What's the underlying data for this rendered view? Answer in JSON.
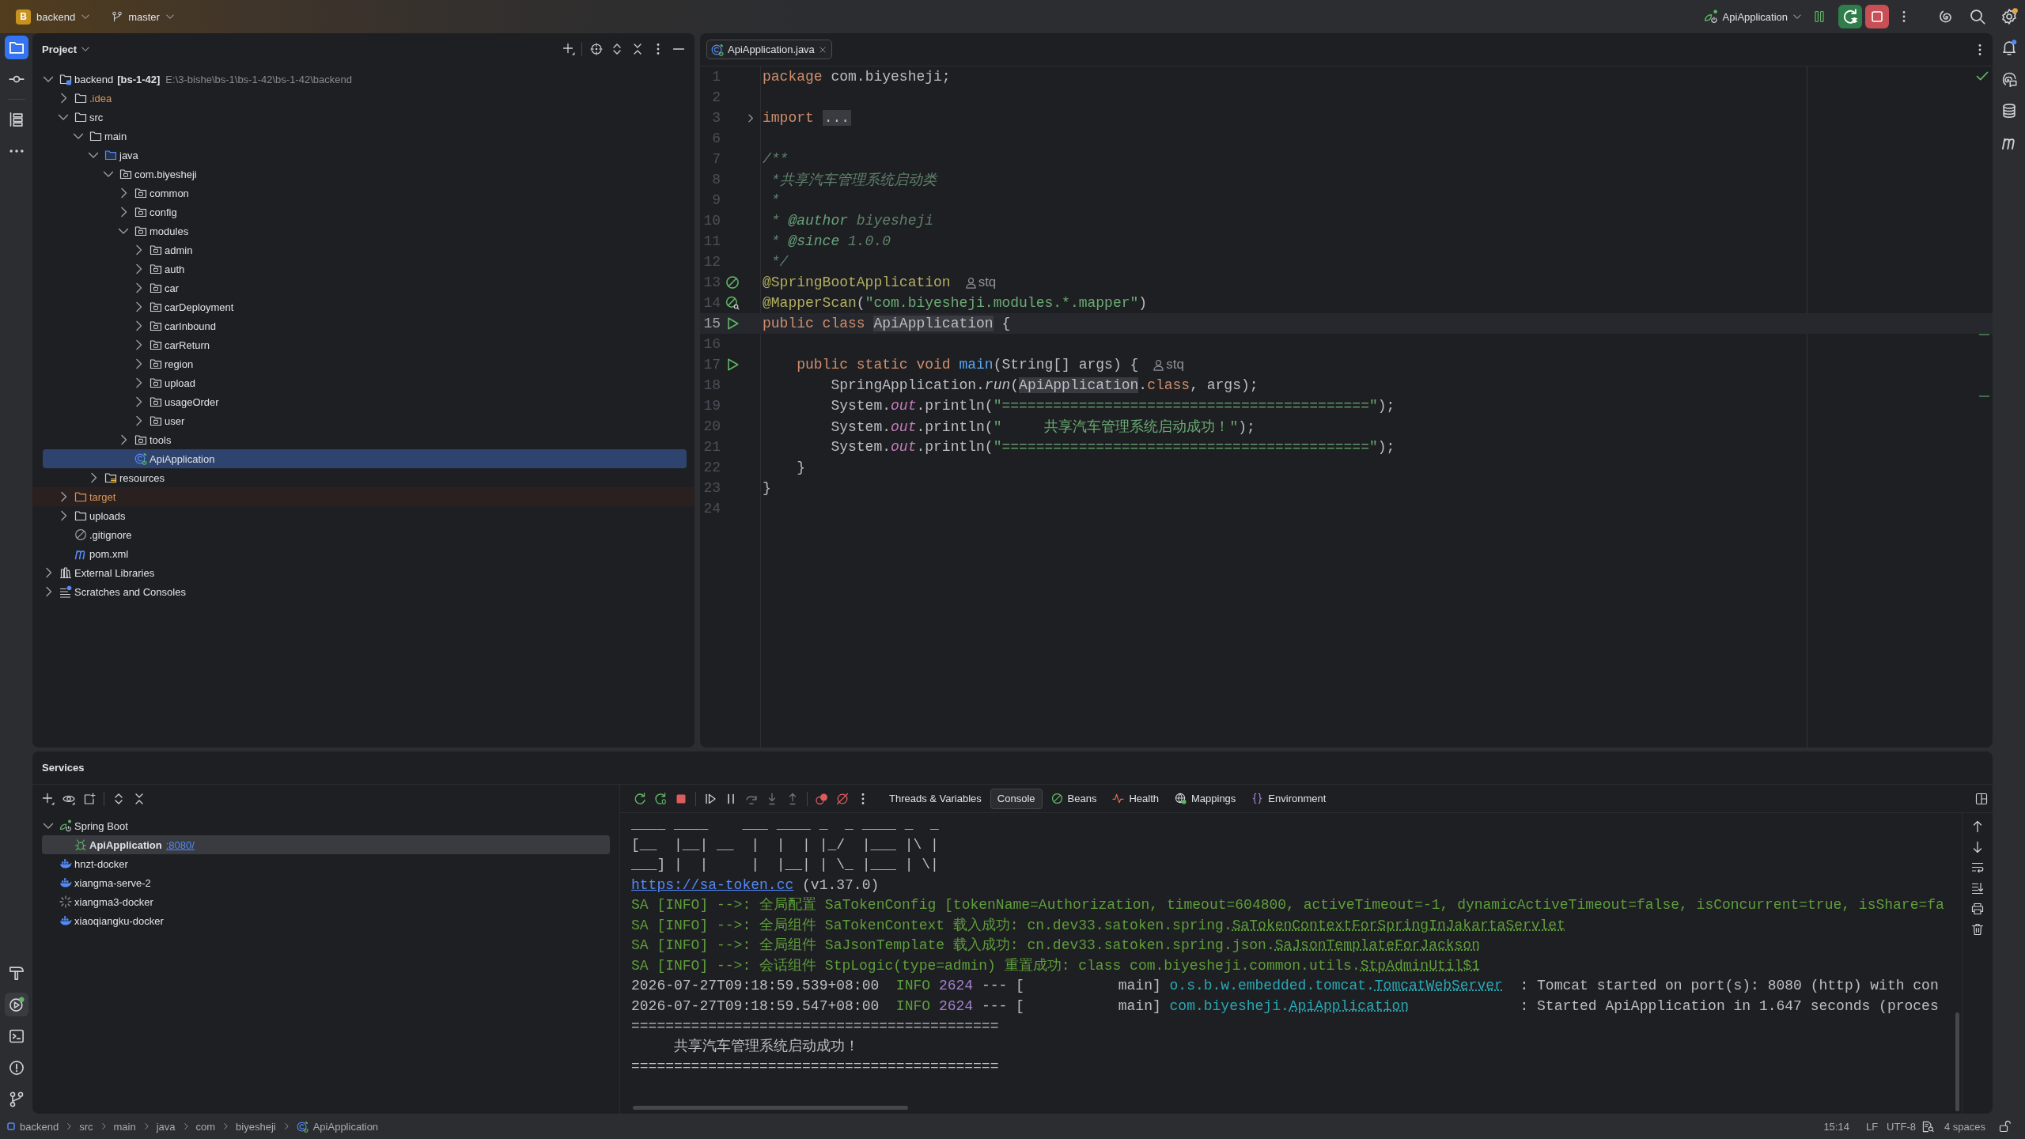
{
  "title_bar": {
    "project_badge": "B",
    "project": "backend",
    "branch": "master",
    "run_config": "ApiApplication"
  },
  "left_strip": {
    "top": [
      {
        "selected": true
      },
      {
        "selected": false
      },
      {
        "selected": false
      }
    ],
    "bottom": [
      {
        "selected": false
      },
      {
        "selected": true
      },
      {
        "selected": false
      },
      {
        "selected": false
      },
      {
        "selected": false
      }
    ]
  },
  "project_panel": {
    "title": "Project",
    "tree": [
      {
        "name": "backend",
        "module": "[bs-1-42]",
        "path": "E:\\3-bishe\\bs-1\\bs-1-42\\bs-1-42\\backend",
        "kind": "module",
        "expanded": true,
        "selected": false,
        "children": [
          {
            "name": ".idea",
            "kind": "ignored-folder",
            "expanded": false,
            "selected": false
          },
          {
            "name": "src",
            "kind": "folder",
            "expanded": true,
            "selected": false,
            "children": [
              {
                "name": "main",
                "kind": "folder",
                "expanded": true,
                "selected": false,
                "children": [
                  {
                    "name": "java",
                    "kind": "source-root",
                    "expanded": true,
                    "selected": false,
                    "children": [
                      {
                        "name": "com.biyesheji",
                        "kind": "package",
                        "expanded": true,
                        "selected": false,
                        "children": [
                          {
                            "name": "common",
                            "kind": "package",
                            "expanded": false,
                            "selected": false
                          },
                          {
                            "name": "config",
                            "kind": "package",
                            "expanded": false,
                            "selected": false
                          },
                          {
                            "name": "modules",
                            "kind": "package",
                            "expanded": true,
                            "selected": false,
                            "children": [
                              {
                                "name": "admin",
                                "kind": "package",
                                "expanded": false,
                                "selected": false
                              },
                              {
                                "name": "auth",
                                "kind": "package",
                                "expanded": false,
                                "selected": false
                              },
                              {
                                "name": "car",
                                "kind": "package",
                                "expanded": false,
                                "selected": false
                              },
                              {
                                "name": "carDeployment",
                                "kind": "package",
                                "expanded": false,
                                "selected": false
                              },
                              {
                                "name": "carInbound",
                                "kind": "package",
                                "expanded": false,
                                "selected": false
                              },
                              {
                                "name": "carReturn",
                                "kind": "package",
                                "expanded": false,
                                "selected": false
                              },
                              {
                                "name": "region",
                                "kind": "package",
                                "expanded": false,
                                "selected": false
                              },
                              {
                                "name": "upload",
                                "kind": "package",
                                "expanded": false,
                                "selected": false
                              },
                              {
                                "name": "usageOrder",
                                "kind": "package",
                                "expanded": false,
                                "selected": false
                              },
                              {
                                "name": "user",
                                "kind": "package",
                                "expanded": false,
                                "selected": false
                              }
                            ]
                          },
                          {
                            "name": "tools",
                            "kind": "package",
                            "expanded": false,
                            "selected": false
                          },
                          {
                            "name": "ApiApplication",
                            "kind": "spring-class",
                            "selected": true
                          }
                        ]
                      }
                    ]
                  },
                  {
                    "name": "resources",
                    "kind": "resources-root",
                    "expanded": false,
                    "selected": false
                  }
                ]
              }
            ]
          },
          {
            "name": "target",
            "kind": "excluded-folder",
            "expanded": false,
            "selected": false
          },
          {
            "name": "uploads",
            "kind": "folder",
            "expanded": false,
            "selected": false
          },
          {
            "name": ".gitignore",
            "kind": "ignore-file",
            "selected": false
          },
          {
            "name": "pom.xml",
            "kind": "maven-file",
            "selected": false
          }
        ]
      },
      {
        "name": "External Libraries",
        "kind": "libraries",
        "expanded": false,
        "selected": false
      },
      {
        "name": "Scratches and Consoles",
        "kind": "scratches",
        "expanded": false,
        "selected": false
      }
    ]
  },
  "editor": {
    "tabs": [
      {
        "label": "ApiApplication.java",
        "selected": true
      }
    ],
    "lines": [
      {
        "number": "1",
        "current": false,
        "tokens": [
          {
            "kind": "keyword",
            "text": "package"
          },
          {
            "kind": "plain",
            "text": " com.biyesheji;"
          }
        ]
      },
      {
        "number": "2",
        "current": false
      },
      {
        "number": "3",
        "current": false,
        "gutter": {
          "kind": "fold"
        },
        "tokens": [
          {
            "kind": "keyword",
            "text": "import "
          },
          {
            "kind": "folded",
            "text": "..."
          }
        ]
      },
      {
        "number": "6",
        "current": false
      },
      {
        "number": "7",
        "current": false,
        "tokens": [
          {
            "kind": "doc",
            "text": "/**"
          }
        ]
      },
      {
        "number": "8",
        "current": false,
        "tokens": [
          {
            "kind": "doc",
            "text": " *共享汽车管理系统启动类"
          }
        ]
      },
      {
        "number": "9",
        "current": false,
        "tokens": [
          {
            "kind": "doc",
            "text": " *"
          }
        ]
      },
      {
        "number": "10",
        "current": false,
        "tokens": [
          {
            "kind": "doc",
            "text": " * "
          },
          {
            "kind": "doc-tag",
            "text": "@author"
          },
          {
            "kind": "doc",
            "text": " biyesheji"
          }
        ]
      },
      {
        "number": "11",
        "current": false,
        "tokens": [
          {
            "kind": "doc",
            "text": " * "
          },
          {
            "kind": "doc-tag",
            "text": "@since"
          },
          {
            "kind": "doc",
            "text": " 1.0.0"
          }
        ]
      },
      {
        "number": "12",
        "current": false,
        "tokens": [
          {
            "kind": "doc",
            "text": " */"
          }
        ]
      },
      {
        "number": "13",
        "current": false,
        "gutter": {
          "kind": "bean"
        },
        "tokens": [
          {
            "kind": "annotation",
            "text": "@SpringBootApplication"
          }
        ],
        "hint": "stq"
      },
      {
        "number": "14",
        "current": false,
        "gutter": {
          "kind": "mapper"
        },
        "tokens": [
          {
            "kind": "annotation",
            "text": "@MapperScan"
          },
          {
            "kind": "plain",
            "text": "("
          },
          {
            "kind": "string",
            "text": "\"com.biyesheji.modules.*.mapper\""
          },
          {
            "kind": "plain",
            "text": ")"
          }
        ]
      },
      {
        "number": "15",
        "current": true,
        "gutter": {
          "kind": "run"
        },
        "tokens": [
          {
            "kind": "keyword",
            "text": "public class "
          },
          {
            "kind": "usage",
            "text": "ApiApplication"
          },
          {
            "kind": "plain",
            "text": " {"
          }
        ]
      },
      {
        "number": "16",
        "current": false
      },
      {
        "number": "17",
        "current": false,
        "gutter": {
          "kind": "run"
        },
        "tokens": [
          {
            "kind": "keyword",
            "text": "    public static void "
          },
          {
            "kind": "method",
            "text": "main"
          },
          {
            "kind": "plain",
            "text": "(String[] args) {"
          }
        ],
        "hint": "stq"
      },
      {
        "number": "18",
        "current": false,
        "tokens": [
          {
            "kind": "plain",
            "text": "        SpringApplication."
          },
          {
            "kind": "static-call",
            "text": "run"
          },
          {
            "kind": "plain",
            "text": "("
          },
          {
            "kind": "usage",
            "text": "ApiApplication"
          },
          {
            "kind": "plain",
            "text": "."
          },
          {
            "kind": "keyword",
            "text": "class"
          },
          {
            "kind": "plain",
            "text": ", args);"
          }
        ]
      },
      {
        "number": "19",
        "current": false,
        "tokens": [
          {
            "kind": "plain",
            "text": "        System."
          },
          {
            "kind": "static-field",
            "text": "out"
          },
          {
            "kind": "plain",
            "text": ".println("
          },
          {
            "kind": "string",
            "text": "\"===========================================\""
          },
          {
            "kind": "plain",
            "text": ");"
          }
        ]
      },
      {
        "number": "20",
        "current": false,
        "tokens": [
          {
            "kind": "plain",
            "text": "        System."
          },
          {
            "kind": "static-field",
            "text": "out"
          },
          {
            "kind": "plain",
            "text": ".println("
          },
          {
            "kind": "string",
            "text": "\"     共享汽车管理系统启动成功！\""
          },
          {
            "kind": "plain",
            "text": ");"
          }
        ]
      },
      {
        "number": "21",
        "current": false,
        "tokens": [
          {
            "kind": "plain",
            "text": "        System."
          },
          {
            "kind": "static-field",
            "text": "out"
          },
          {
            "kind": "plain",
            "text": ".println("
          },
          {
            "kind": "string",
            "text": "\"===========================================\""
          },
          {
            "kind": "plain",
            "text": ");"
          }
        ]
      },
      {
        "number": "22",
        "current": false,
        "tokens": [
          {
            "kind": "plain",
            "text": "    }"
          }
        ]
      },
      {
        "number": "23",
        "current": false,
        "tokens": [
          {
            "kind": "plain",
            "text": "}"
          }
        ]
      },
      {
        "number": "24",
        "current": false
      }
    ]
  },
  "services": {
    "title": "Services",
    "tree": [
      {
        "name": "Spring Boot",
        "kind": "spring-boot",
        "expanded": true,
        "selected": false,
        "children": [
          {
            "name": "ApiApplication",
            "port": ":8080/",
            "kind": "spring-app",
            "selected": true
          }
        ]
      },
      {
        "name": "hnzt-docker",
        "kind": "docker",
        "selected": false
      },
      {
        "name": "xiangma-serve-2",
        "kind": "docker",
        "selected": false
      },
      {
        "name": "xiangma3-docker",
        "kind": "docker-connecting",
        "selected": false
      },
      {
        "name": "xiaoqiangku-docker",
        "kind": "docker",
        "selected": false
      }
    ],
    "console_tabs": [
      {
        "label": "Threads & Variables",
        "selected": false
      },
      {
        "label": "Console",
        "selected": true
      },
      {
        "label": "Beans",
        "selected": false
      },
      {
        "label": "Health",
        "selected": false
      },
      {
        "label": "Mappings",
        "selected": false
      },
      {
        "label": "Environment",
        "selected": false
      }
    ],
    "console_lines": [
      {
        "tokens": [
          {
            "kind": "plain",
            "text": "____ ____    ___ ____ _  _ ____ _  _"
          }
        ]
      },
      {
        "tokens": [
          {
            "kind": "plain",
            "text": "[__  |__| __  |  |  | |_/  |___ |\\ |"
          }
        ]
      },
      {
        "tokens": [
          {
            "kind": "plain",
            "text": "___] |  |     |  |__| | \\_ |___ | \\|"
          }
        ]
      },
      {
        "tokens": [
          {
            "kind": "link",
            "text": "https://sa-token.cc"
          },
          {
            "kind": "plain",
            "text": " (v1.37.0)"
          }
        ]
      },
      {
        "tokens": [
          {
            "kind": "sa",
            "text": "SA [INFO] -->: 全局配置 SaTokenConfig [tokenName=Authorization, timeout=604800, activeTimeout=-1, dynamicActiveTimeout=false, isConcurrent=true, isShare=fa"
          }
        ]
      },
      {
        "tokens": [
          {
            "kind": "sa",
            "text": "SA [INFO] -->: 全局组件 SaTokenContext 载入成功: cn.dev33.satoken.spring."
          },
          {
            "kind": "sa-link",
            "text": "SaTokenContextForSpringInJakartaServlet"
          }
        ]
      },
      {
        "tokens": [
          {
            "kind": "sa",
            "text": "SA [INFO] -->: 全局组件 SaJsonTemplate 载入成功: cn.dev33.satoken.spring.json."
          },
          {
            "kind": "sa-link",
            "text": "SaJsonTemplateForJackson"
          }
        ]
      },
      {
        "tokens": [
          {
            "kind": "sa",
            "text": "SA [INFO] -->: 会话组件 StpLogic(type=admin) 重置成功: class com.biyesheji.common.utils."
          },
          {
            "kind": "sa-link",
            "text": "StpAdminUtil$1"
          }
        ]
      },
      {
        "tokens": [
          {
            "kind": "plain",
            "text": "2026-07-27T09:18:59.539+08:00  "
          },
          {
            "kind": "level",
            "text": "INFO "
          },
          {
            "kind": "pid",
            "text": "2624"
          },
          {
            "kind": "plain",
            "text": " --- [           main] "
          },
          {
            "kind": "logger",
            "text": "o.s.b.w.embedded.tomcat."
          },
          {
            "kind": "logger-link",
            "text": "TomcatWebServer"
          },
          {
            "kind": "plain",
            "text": "  : Tomcat started on port(s): 8080 (http) with con"
          }
        ]
      },
      {
        "tokens": [
          {
            "kind": "plain",
            "text": "2026-07-27T09:18:59.547+08:00  "
          },
          {
            "kind": "level",
            "text": "INFO "
          },
          {
            "kind": "pid",
            "text": "2624"
          },
          {
            "kind": "plain",
            "text": " --- [           main] "
          },
          {
            "kind": "logger",
            "text": "com.biyesheji."
          },
          {
            "kind": "logger-link",
            "text": "ApiApplication"
          },
          {
            "kind": "plain",
            "text": "             : Started ApiApplication in 1.647 seconds (proces"
          }
        ]
      },
      {
        "tokens": [
          {
            "kind": "plain",
            "text": "==========================================="
          }
        ]
      },
      {
        "tokens": [
          {
            "kind": "plain",
            "text": "     共享汽车管理系统启动成功！"
          }
        ]
      },
      {
        "tokens": [
          {
            "kind": "plain",
            "text": "==========================================="
          }
        ]
      }
    ]
  },
  "status_bar": {
    "breadcrumbs": [
      {
        "label": "backend",
        "kind": "module"
      },
      {
        "label": "src",
        "kind": "folder"
      },
      {
        "label": "main",
        "kind": "folder"
      },
      {
        "label": "java",
        "kind": "folder"
      },
      {
        "label": "com",
        "kind": "folder"
      },
      {
        "label": "biyesheji",
        "kind": "folder"
      },
      {
        "label": "ApiApplication",
        "kind": "class"
      }
    ],
    "caret": "15:14",
    "line_separator": "LF",
    "encoding": "UTF-8",
    "indent": "4 spaces"
  }
}
